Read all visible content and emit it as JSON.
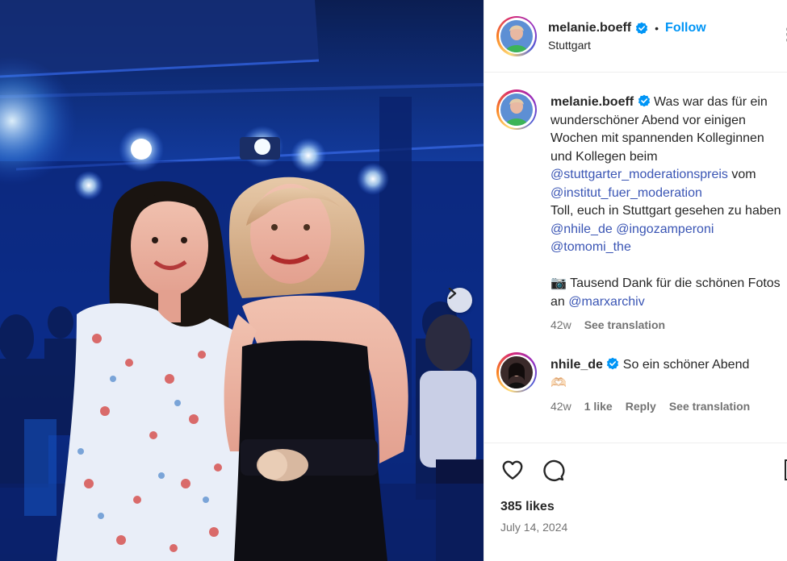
{
  "post": {
    "username": "melanie.boeff",
    "follow_label": "Follow",
    "dot": "•",
    "location": "Stuttgart",
    "more_label": "⋮",
    "caption": {
      "author": "melanie.boeff",
      "line1": " Was war das für ein",
      "line2": "wunderschöner Abend vor einigen",
      "line3": "Wochen mit spannenden Kolleginnen",
      "line4": "und Kollegen beim",
      "mention1": "@stuttgarter_moderationspreis",
      "after_mention1": " vom",
      "mention2": "@institut_fuer_moderation",
      "line7": "Toll, euch in Stuttgart gesehen zu haben",
      "mention3": "@nhile_de",
      "mention4": "@ingozamperoni",
      "mention5": "@tomomi_the",
      "thanks": "📷 Tausend Dank für die schönen Fotos",
      "an": "an ",
      "mention6": "@marxarchiv",
      "age": "42w",
      "see_translation": "See translation"
    },
    "comment": {
      "author": "nhile_de",
      "text": " So ein schöner Abend",
      "emoji": "🫶🏻",
      "age": "42w",
      "likes": "1 like",
      "reply": "Reply",
      "see_translation": "See translation"
    },
    "likes": "385 likes",
    "date": "July 14, 2024"
  },
  "icons": {
    "heart": "heart-icon",
    "comment": "comment-icon",
    "bookmark": "bookmark-icon",
    "verified": "verified-badge-icon",
    "next": "chevron-right-icon"
  },
  "colors": {
    "link": "#3a55b4",
    "follow": "#0095f6",
    "verified": "#0095f6",
    "muted": "#737373"
  }
}
